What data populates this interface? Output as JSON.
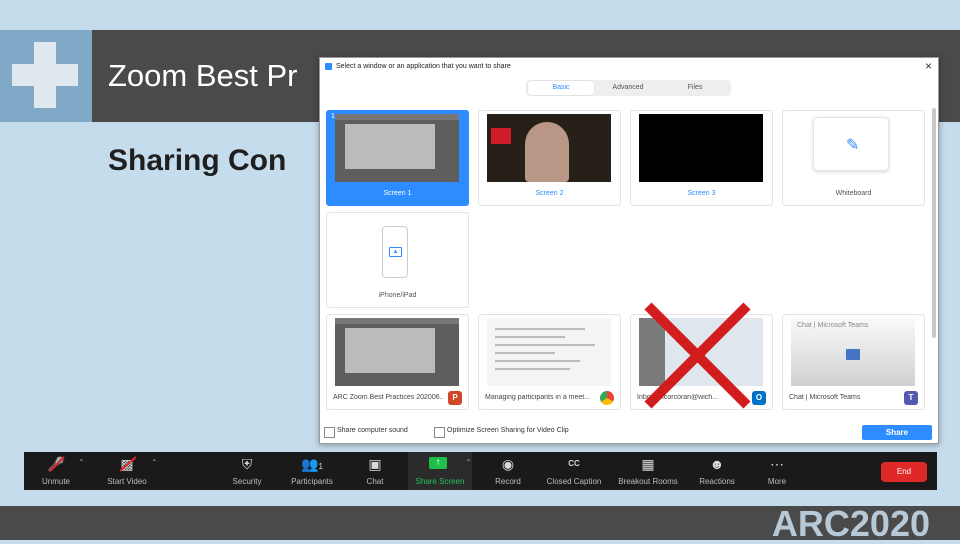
{
  "slide": {
    "title": "Zoom Best Pr",
    "subtitle": "Sharing Con",
    "brand": "ARC2020"
  },
  "dialog": {
    "title": "Select a window or an application that you want to share",
    "close": "×",
    "tabs": [
      {
        "label": "Basic",
        "active": true
      },
      {
        "label": "Advanced",
        "active": false
      },
      {
        "label": "Files",
        "active": false
      }
    ],
    "tiles": [
      {
        "num": "1",
        "label": "Screen 1",
        "selected": true
      },
      {
        "num": "2",
        "label": "Screen 2"
      },
      {
        "num": "3",
        "label": "Screen 3"
      },
      {
        "label": "Whiteboard"
      },
      {
        "label": "iPhone/iPad"
      },
      {
        "label": "ARC Zoom Best Practices 202006...",
        "app": "P"
      },
      {
        "label": "Managing participants in a meet...",
        "app": "chrome"
      },
      {
        "label": "Inbox - kcorcoran@wich...",
        "app": "O"
      },
      {
        "label": "Chat | Microsoft Teams",
        "caption": "Chat | Microsoft Teams",
        "app": "T"
      }
    ],
    "options": {
      "computer_sound": "Share computer sound",
      "optimize": "Optimize Screen Sharing for Video Clip"
    },
    "share_button": "Share"
  },
  "toolbar": {
    "items": [
      {
        "label": "Unmute",
        "icon": "mic-muted-icon"
      },
      {
        "label": "Start Video",
        "icon": "video-off-icon"
      },
      {
        "label": "Security",
        "icon": "shield-icon"
      },
      {
        "label": "Participants",
        "icon": "participants-icon",
        "count": "1"
      },
      {
        "label": "Chat",
        "icon": "chat-icon"
      },
      {
        "label": "Share Screen",
        "icon": "share-screen-icon"
      },
      {
        "label": "Record",
        "icon": "record-icon"
      },
      {
        "label": "Closed Caption",
        "icon": "cc-icon",
        "icon_text": "CC"
      },
      {
        "label": "Breakout Rooms",
        "icon": "breakout-icon"
      },
      {
        "label": "Reactions",
        "icon": "reactions-icon"
      },
      {
        "label": "More",
        "icon": "more-icon"
      }
    ],
    "end_label": "End"
  },
  "colors": {
    "accent": "#2d8cff",
    "slide_bg": "#c5dced",
    "header": "#4a4a4a",
    "end": "#e02828",
    "share_green": "#1fbd4a",
    "red_x": "#d11d1d"
  }
}
